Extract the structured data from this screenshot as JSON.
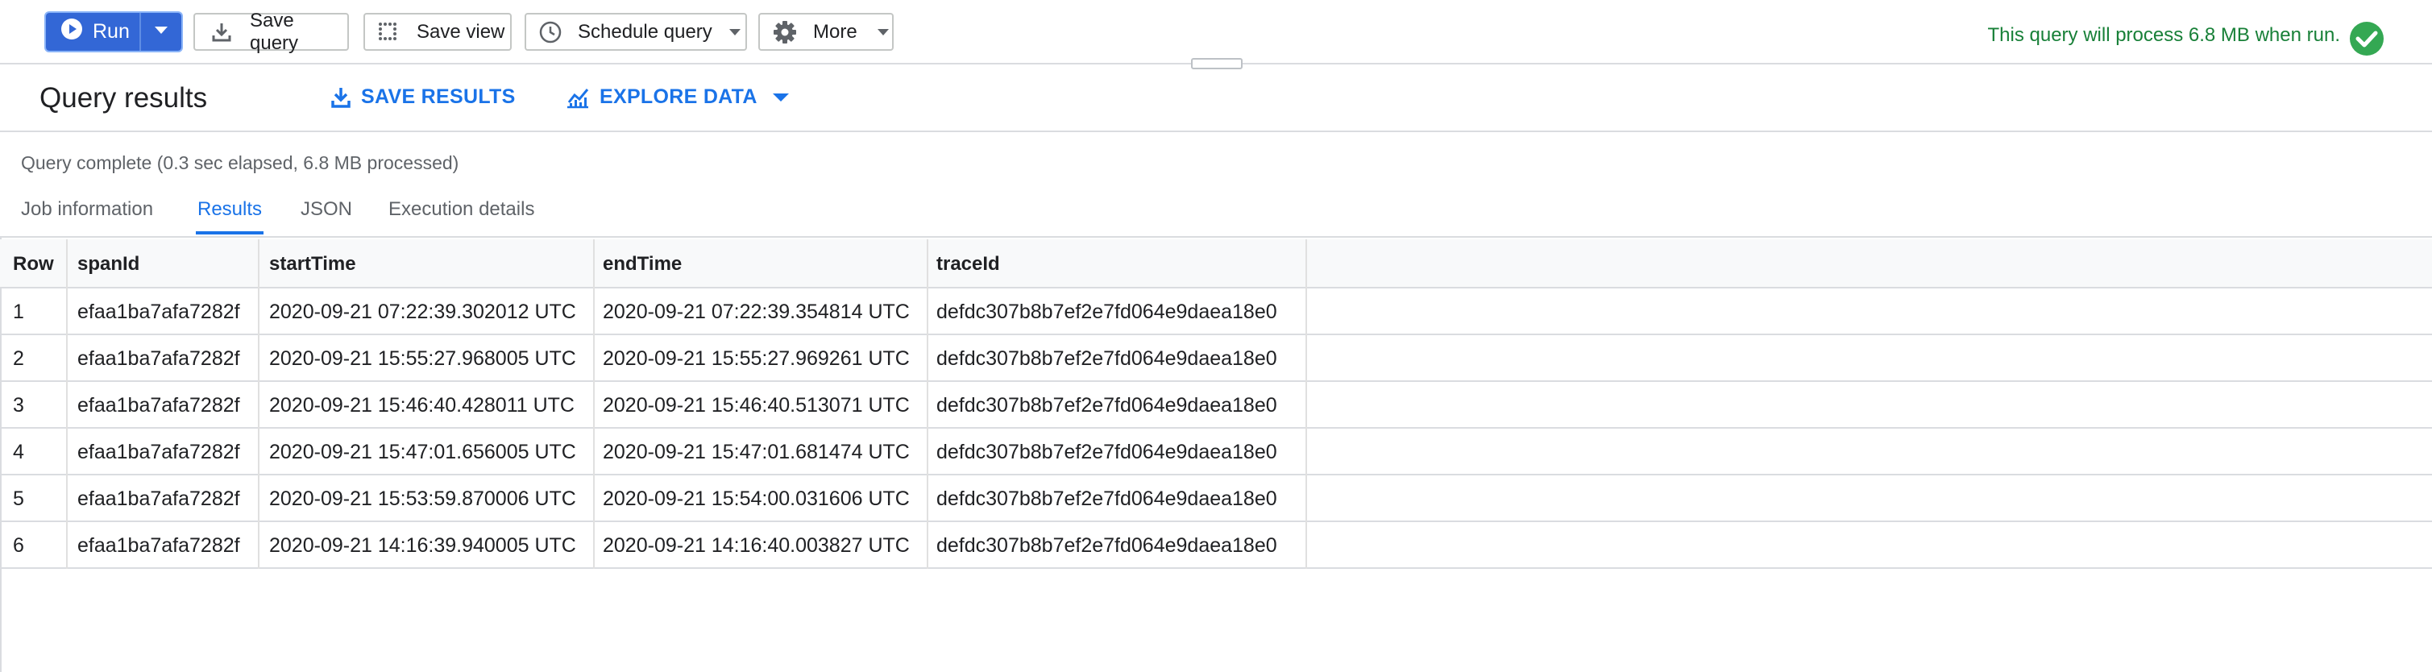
{
  "toolbar": {
    "run_label": "Run",
    "save_query_label": "Save query",
    "save_view_label": "Save view",
    "schedule_query_label": "Schedule query",
    "more_label": "More",
    "process_notice": "This query will process 6.8 MB when run."
  },
  "results": {
    "title": "Query results",
    "save_results_label": "SAVE RESULTS",
    "explore_data_label": "EXPLORE DATA",
    "status": "Query complete (0.3 sec elapsed, 6.8 MB processed)"
  },
  "tabs": [
    "Job information",
    "Results",
    "JSON",
    "Execution details"
  ],
  "active_tab": "Results",
  "table": {
    "columns": [
      "Row",
      "spanId",
      "startTime",
      "endTime",
      "traceId"
    ],
    "rows": [
      [
        "1",
        "efaa1ba7afa7282f",
        "2020-09-21 07:22:39.302012 UTC",
        "2020-09-21 07:22:39.354814 UTC",
        "defdc307b8b7ef2e7fd064e9daea18e0"
      ],
      [
        "2",
        "efaa1ba7afa7282f",
        "2020-09-21 15:55:27.968005 UTC",
        "2020-09-21 15:55:27.969261 UTC",
        "defdc307b8b7ef2e7fd064e9daea18e0"
      ],
      [
        "3",
        "efaa1ba7afa7282f",
        "2020-09-21 15:46:40.428011 UTC",
        "2020-09-21 15:46:40.513071 UTC",
        "defdc307b8b7ef2e7fd064e9daea18e0"
      ],
      [
        "4",
        "efaa1ba7afa7282f",
        "2020-09-21 15:47:01.656005 UTC",
        "2020-09-21 15:47:01.681474 UTC",
        "defdc307b8b7ef2e7fd064e9daea18e0"
      ],
      [
        "5",
        "efaa1ba7afa7282f",
        "2020-09-21 15:53:59.870006 UTC",
        "2020-09-21 15:54:00.031606 UTC",
        "defdc307b8b7ef2e7fd064e9daea18e0"
      ],
      [
        "6",
        "efaa1ba7afa7282f",
        "2020-09-21 14:16:39.940005 UTC",
        "2020-09-21 14:16:40.003827 UTC",
        "defdc307b8b7ef2e7fd064e9daea18e0"
      ]
    ]
  },
  "icons": {
    "run": "play-circle-icon",
    "run_menu": "caret-down-icon",
    "save_query": "download-icon",
    "save_view": "grid-dots-icon",
    "schedule": "clock-icon",
    "more": "gear-icon",
    "notice": "check-circle-icon",
    "save_results": "download-icon",
    "explore_data": "chart-icon"
  },
  "colors": {
    "primary": "#3367d6",
    "link": "#1a73e8",
    "success": "#188038",
    "success_icon": "#34a853"
  }
}
